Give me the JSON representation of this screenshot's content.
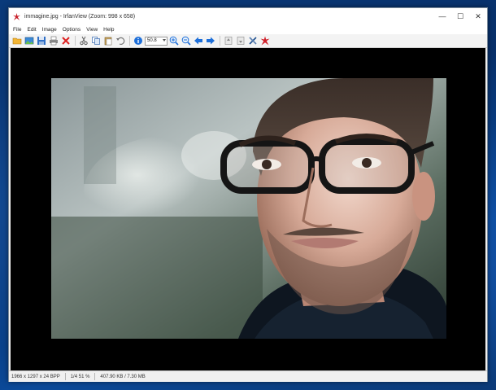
{
  "window": {
    "title": "immagine.jpg - IrfanView (Zoom: 998 x 658)",
    "controls": {
      "minimize": "—",
      "maximize": "☐",
      "close": "✕"
    }
  },
  "menu": [
    "File",
    "Edit",
    "Image",
    "Options",
    "View",
    "Help"
  ],
  "toolbar": {
    "zoom_value": "50.8",
    "buttons": [
      "open-folder-icon",
      "thumbnails-icon",
      "save-icon",
      "print-icon",
      "delete-icon",
      "cut-icon",
      "copy-icon",
      "paste-icon",
      "undo-icon",
      "info-icon",
      "zoom-in-icon",
      "zoom-out-icon",
      "previous-arrow-icon",
      "next-arrow-icon",
      "first-page-icon",
      "last-page-icon",
      "settings-tools-icon",
      "irfanview-cat-icon"
    ]
  },
  "status": {
    "dimensions": "1966 x 1297 x 24 BPP",
    "page_zoom": "1/4  51 %",
    "size": "407.90 KB / 7.30 MB"
  },
  "colors": {
    "accent_blue": "#1e6fd9",
    "delete_red": "#d22",
    "viewer_bg": "#000000"
  }
}
